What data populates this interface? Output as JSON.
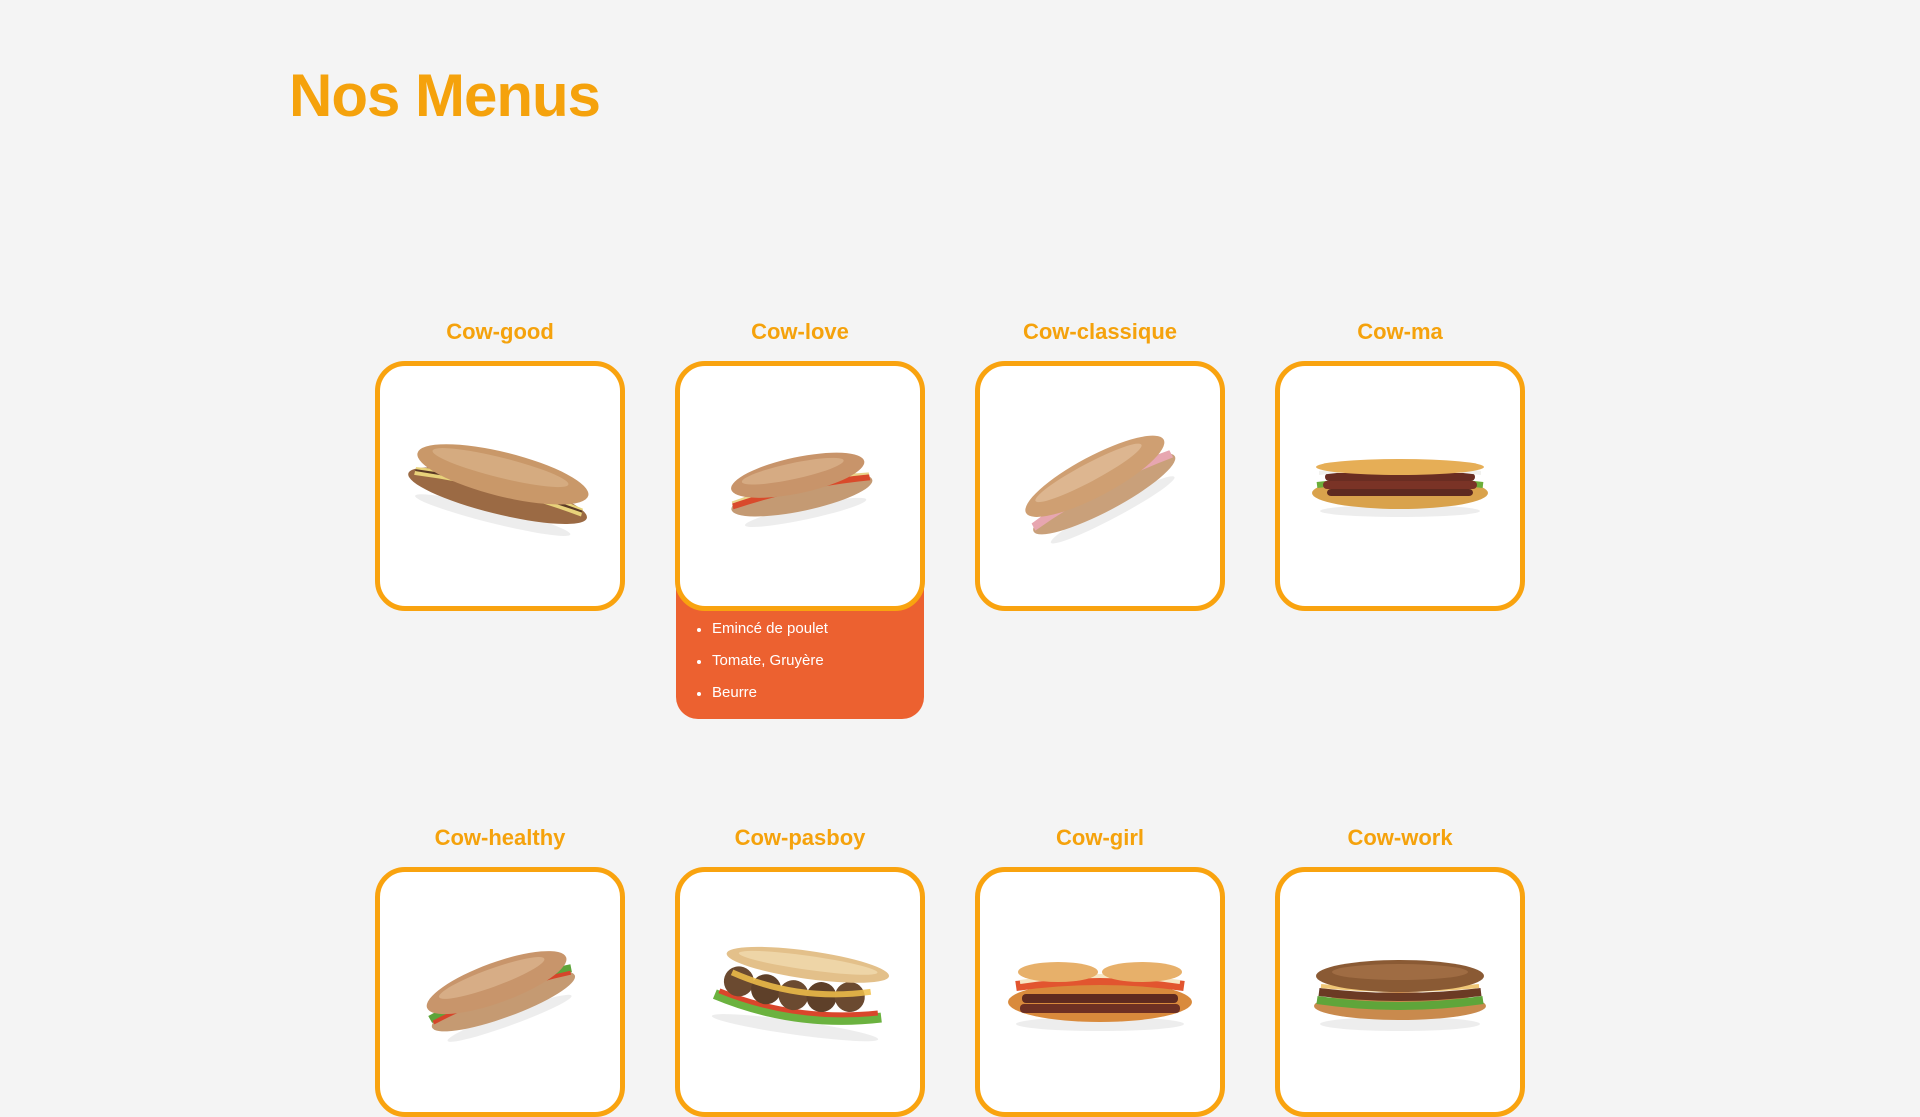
{
  "page": {
    "title": "Nos Menus"
  },
  "colors": {
    "background": "#f4f4f4",
    "accent": "#f5a20c",
    "frame_border": "#f9a30f",
    "ingredients_panel": "#ec6130",
    "ingredients_text": "#ffffff"
  },
  "menus": [
    {
      "name": "Cow-good",
      "image_icon": "baguette-steak-cheese-sandwich-image"
    },
    {
      "name": "Cow-love",
      "image_icon": "baguette-chicken-tomato-sandwich-image",
      "ingredients": [
        "Emincé de poulet",
        "Tomate, Gruyère",
        "Beurre"
      ]
    },
    {
      "name": "Cow-classique",
      "image_icon": "baguette-ham-butter-sandwich-image"
    },
    {
      "name": "Cow-ma",
      "image_icon": "merguez-sausage-sandwich-image"
    },
    {
      "name": "Cow-healthy",
      "image_icon": "baguette-salad-tomato-sandwich-image"
    },
    {
      "name": "Cow-pasboy",
      "image_icon": "meatball-sub-sandwich-image"
    },
    {
      "name": "Cow-girl",
      "image_icon": "double-merguez-sandwich-image"
    },
    {
      "name": "Cow-work",
      "image_icon": "steak-salad-sandwich-image"
    }
  ]
}
